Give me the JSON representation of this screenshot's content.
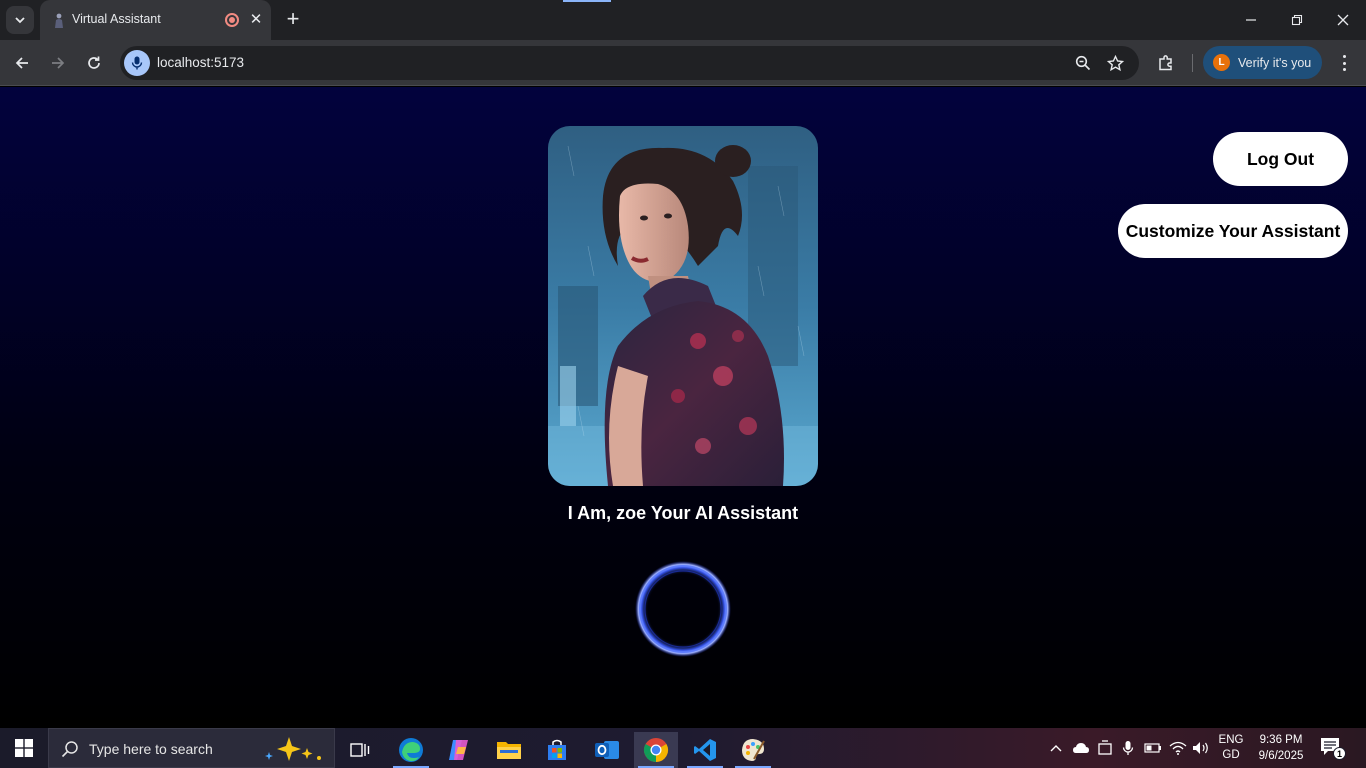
{
  "browser": {
    "tab_title": "Virtual Assistant",
    "tab_close": "✕",
    "new_tab": "+",
    "url": "localhost:5173",
    "verify_label": "Verify it's you",
    "profile_initial": "L"
  },
  "page": {
    "assistant_text": "I Am, zoe Your AI Assistant",
    "logout_label": "Log Out",
    "customize_label": "Customize Your Assistant"
  },
  "taskbar": {
    "search_placeholder": "Type here to search",
    "lang_top": "ENG",
    "lang_bottom": "GD",
    "time": "9:36 PM",
    "date": "9/6/2025",
    "notification_count": "1"
  },
  "colors": {
    "page_top": "#02023d",
    "page_bottom": "#000000",
    "button_bg": "#ffffff",
    "ring_glow": "#3a5bff"
  }
}
